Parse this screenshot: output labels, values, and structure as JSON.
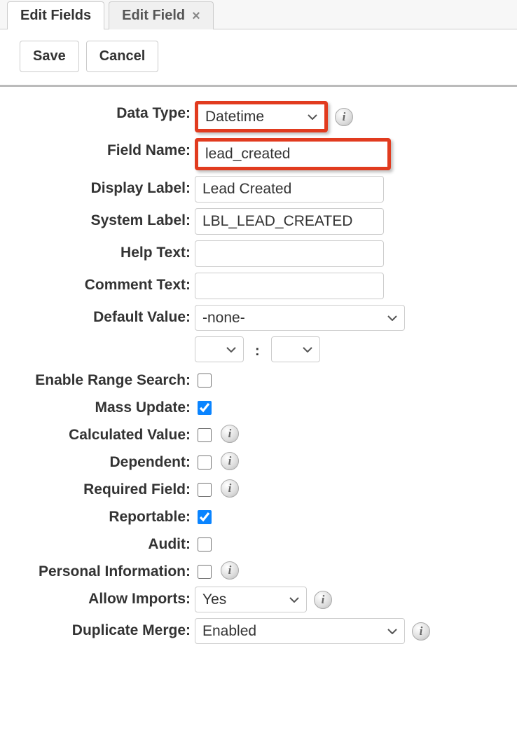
{
  "tabs": {
    "edit_fields": "Edit Fields",
    "edit_field": "Edit Field"
  },
  "toolbar": {
    "save": "Save",
    "cancel": "Cancel"
  },
  "labels": {
    "data_type": "Data Type:",
    "field_name": "Field Name:",
    "display_label": "Display Label:",
    "system_label": "System Label:",
    "help_text": "Help Text:",
    "comment_text": "Comment Text:",
    "default_value": "Default Value:",
    "enable_range_search": "Enable Range Search:",
    "mass_update": "Mass Update:",
    "calculated_value": "Calculated Value:",
    "dependent": "Dependent:",
    "required_field": "Required Field:",
    "reportable": "Reportable:",
    "audit": "Audit:",
    "personal_information": "Personal Information:",
    "allow_imports": "Allow Imports:",
    "duplicate_merge": "Duplicate Merge:"
  },
  "values": {
    "data_type": "Datetime",
    "field_name": "lead_created",
    "display_label": "Lead Created",
    "system_label": "LBL_LEAD_CREATED",
    "help_text": "",
    "comment_text": "",
    "default_value": "-none-",
    "default_hour": "",
    "default_minute": "",
    "enable_range_search": false,
    "mass_update": true,
    "calculated_value": false,
    "dependent": false,
    "required_field": false,
    "reportable": true,
    "audit": false,
    "personal_information": false,
    "allow_imports": "Yes",
    "duplicate_merge": "Enabled"
  },
  "icons": {
    "info": "i",
    "close": "×"
  }
}
